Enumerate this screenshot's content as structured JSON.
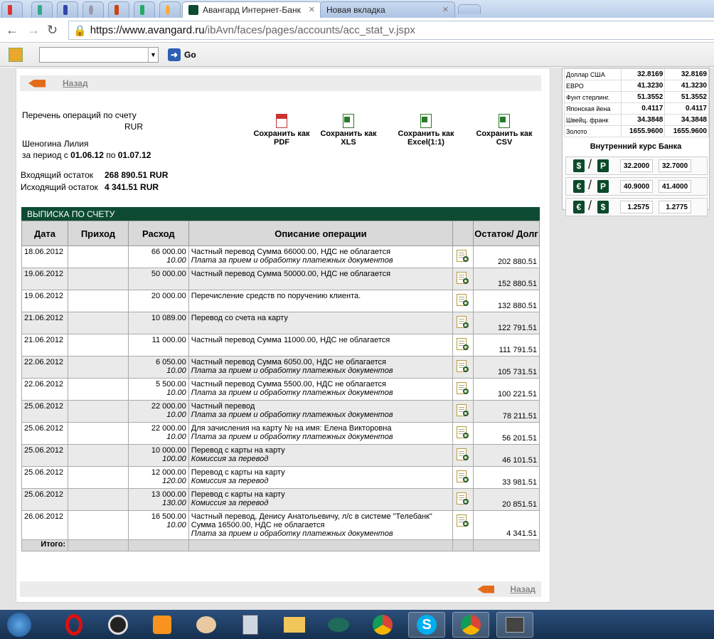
{
  "browser": {
    "tabs": [
      "Авангард Интернет-Банк",
      "Новая вкладка"
    ],
    "url_host": "https://www.avangard.ru",
    "url_path": "/ibAvn/faces/pages/accounts/acc_stat_v.jspx",
    "go_label": "Go"
  },
  "page": {
    "back": "Назад",
    "title": "Перечень операций по счету",
    "currency": "RUR",
    "owner": "Шеногина Лилия",
    "period_prefix": "за период с",
    "period_from": "01.06.12",
    "period_mid": "по",
    "period_to": "01.07.12",
    "in_label": "Входящий остаток",
    "in_value": "268 890.51 RUR",
    "out_label": "Исходящий остаток",
    "out_value": "4 341.51 RUR",
    "save": [
      {
        "l1": "Сохранить как",
        "l2": "PDF"
      },
      {
        "l1": "Сохранить как",
        "l2": "XLS"
      },
      {
        "l1": "Сохранить как",
        "l2": "Excel(1:1)"
      },
      {
        "l1": "Сохранить как",
        "l2": "CSV"
      }
    ],
    "statement_title": "ВЫПИСКА ПО СЧЕТУ",
    "cols": [
      "Дата",
      "Приход",
      "Расход",
      "Описание операции",
      "",
      "Остаток/ Долг"
    ],
    "rows": [
      {
        "d": "18.06.2012",
        "out": "66 000.00",
        "fee": "10.00",
        "desc": "Частный перевод Сумма 66000.00, НДС не облагается",
        "fdesc": "Плата за прием и обработку платежных документов",
        "bal": "202 880.51"
      },
      {
        "d": "19.06.2012",
        "out": "50 000.00",
        "fee": "",
        "desc": "Частный перевод Сумма 50000.00, НДС не облагается",
        "fdesc": "",
        "bal": "152 880.51"
      },
      {
        "d": "19.06.2012",
        "out": "20 000.00",
        "fee": "",
        "desc": "Перечисление средств по поручению клиента.",
        "fdesc": "",
        "bal": "132 880.51"
      },
      {
        "d": "21.06.2012",
        "out": "10 089.00",
        "fee": "",
        "desc": "Перевод со счета на карту",
        "fdesc": "",
        "bal": "122 791.51"
      },
      {
        "d": "21.06.2012",
        "out": "11 000.00",
        "fee": "",
        "desc": "Частный перевод Сумма 11000.00, НДС не облагается",
        "fdesc": "",
        "bal": "111 791.51"
      },
      {
        "d": "22.06.2012",
        "out": "6 050.00",
        "fee": "10.00",
        "desc": "Частный перевод Сумма 6050.00, НДС не облагается",
        "fdesc": "Плата за прием и обработку платежных документов",
        "bal": "105 731.51"
      },
      {
        "d": "22.06.2012",
        "out": "5 500.00",
        "fee": "10.00",
        "desc": "Частный перевод Сумма 5500.00, НДС не облагается",
        "fdesc": "Плата за прием и обработку платежных документов",
        "bal": "100 221.51"
      },
      {
        "d": "25.06.2012",
        "out": "22 000.00",
        "fee": "10.00",
        "desc": "Частный перевод",
        "fdesc": "Плата за прием и обработку платежных документов",
        "bal": "78 211.51"
      },
      {
        "d": "25.06.2012",
        "out": "22 000.00",
        "fee": "10.00",
        "desc": "Для зачисления на карту №                                на имя:          Елена Викторовна",
        "fdesc": "Плата за прием и обработку платежных документов",
        "bal": "56 201.51"
      },
      {
        "d": "25.06.2012",
        "out": "10 000.00",
        "fee": "100.00",
        "desc": "Перевод с карты на карту",
        "fdesc": "Комиссия за перевод",
        "bal": "46 101.51"
      },
      {
        "d": "25.06.2012",
        "out": "12 000.00",
        "fee": "120.00",
        "desc": "Перевод с карты на карту",
        "fdesc": "Комиссия за перевод",
        "bal": "33 981.51"
      },
      {
        "d": "25.06.2012",
        "out": "13 000.00",
        "fee": "130.00",
        "desc": "Перевод с карты на карту",
        "fdesc": "Комиссия за перевод",
        "bal": "20 851.51"
      },
      {
        "d": "26.06.2012",
        "out": "16 500.00",
        "fee": "10.00",
        "desc": "Частный перевод,                 Денису Анатольевичу, л/с                                         в системе \"Телебанк\" Сумма 16500.00, НДС не облагается",
        "fdesc": "Плата за прием и обработку платежных документов",
        "bal": "4 341.51"
      }
    ],
    "total_label": "Итого:"
  },
  "rates": {
    "rows": [
      [
        "Доллар США",
        "32.8169",
        "32.8169"
      ],
      [
        "ЕВРО",
        "41.3230",
        "41.3230"
      ],
      [
        "Фунт стерлинг.",
        "51.3552",
        "51.3552"
      ],
      [
        "Японская йена",
        "0.4117",
        "0.4117"
      ],
      [
        "Швейц. франк",
        "34.3848",
        "34.3848"
      ],
      [
        "Золото",
        "1655.9600",
        "1655.9600"
      ]
    ],
    "internal_title": "Внутренний курс Банка",
    "internal": [
      {
        "a": "$",
        "b": "Р",
        "v1": "32.2000",
        "v2": "32.7000"
      },
      {
        "a": "€",
        "b": "Р",
        "v1": "40.9000",
        "v2": "41.4000"
      },
      {
        "a": "€",
        "b": "$",
        "v1": "1.2575",
        "v2": "1.2775"
      }
    ]
  }
}
